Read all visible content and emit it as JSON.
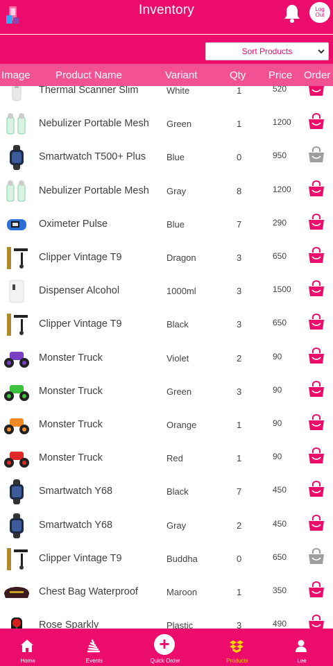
{
  "header": {
    "title": "Inventory",
    "logout_line1": "Log",
    "logout_line2": "Out"
  },
  "sort": {
    "selected": "Sort Products"
  },
  "table": {
    "columns": [
      "Image",
      "Product Name",
      "Variant",
      "Qty",
      "Price",
      "Order"
    ],
    "rows": [
      {
        "name": "Thermal Scanner Slim",
        "variant": "White",
        "qty": "1",
        "price": "520",
        "img": "scanner-image",
        "available": true
      },
      {
        "name": "Nebulizer Portable Mesh",
        "variant": "Green",
        "qty": "1",
        "price": "1200",
        "img": "nebulizer-image",
        "available": true
      },
      {
        "name": "Smartwatch T500+ Plus",
        "variant": "Blue",
        "qty": "0",
        "price": "950",
        "img": "smartwatch-image",
        "available": false
      },
      {
        "name": "Nebulizer Portable Mesh",
        "variant": "Gray",
        "qty": "8",
        "price": "1200",
        "img": "nebulizer-image",
        "available": true
      },
      {
        "name": "Oximeter Pulse",
        "variant": "Blue",
        "qty": "7",
        "price": "290",
        "img": "oximeter-image",
        "available": true
      },
      {
        "name": "Clipper Vintage T9",
        "variant": "Dragon",
        "qty": "3",
        "price": "650",
        "img": "clipper-image",
        "available": true
      },
      {
        "name": "Dispenser Alcohol",
        "variant": "1000ml",
        "qty": "3",
        "price": "1500",
        "img": "dispenser-image",
        "available": true
      },
      {
        "name": "Clipper Vintage T9",
        "variant": "Black",
        "qty": "3",
        "price": "650",
        "img": "clipper-image",
        "available": true
      },
      {
        "name": "Monster Truck",
        "variant": "Violet",
        "qty": "2",
        "price": "90",
        "img": "truck-image",
        "available": true
      },
      {
        "name": "Monster Truck",
        "variant": "Green",
        "qty": "3",
        "price": "90",
        "img": "truck-image",
        "available": true
      },
      {
        "name": "Monster Truck",
        "variant": "Orange",
        "qty": "1",
        "price": "90",
        "img": "truck-image",
        "available": true
      },
      {
        "name": "Monster Truck",
        "variant": "Red",
        "qty": "1",
        "price": "90",
        "img": "truck-image",
        "available": true
      },
      {
        "name": "Smartwatch Y68",
        "variant": "Black",
        "qty": "7",
        "price": "450",
        "img": "smartwatch-image",
        "available": true
      },
      {
        "name": "Smartwatch Y68",
        "variant": "Gray",
        "qty": "2",
        "price": "450",
        "img": "smartwatch-image",
        "available": true
      },
      {
        "name": "Clipper Vintage T9",
        "variant": "Buddha",
        "qty": "0",
        "price": "650",
        "img": "clipper-image",
        "available": false
      },
      {
        "name": "Chest Bag Waterproof",
        "variant": "Maroon",
        "qty": "1",
        "price": "350",
        "img": "bag-image",
        "available": true
      },
      {
        "name": "Rose Sparkly",
        "variant": "Plastic",
        "qty": "3",
        "price": "490",
        "img": "rose-image",
        "available": true
      }
    ]
  },
  "nav": {
    "items": [
      {
        "label": "Home",
        "icon": "home-icon"
      },
      {
        "label": "Events",
        "icon": "events-icon"
      },
      {
        "label": "Quick Order",
        "icon": "plus-icon"
      },
      {
        "label": "Products",
        "icon": "box-icon",
        "active": true
      },
      {
        "label": "Lee",
        "icon": "user-icon"
      }
    ]
  },
  "colors": {
    "primary": "#ec0c6c",
    "table_header": "#f25294",
    "active_nav": "#ffd400",
    "disabled_bag": "#9e9e9e"
  }
}
